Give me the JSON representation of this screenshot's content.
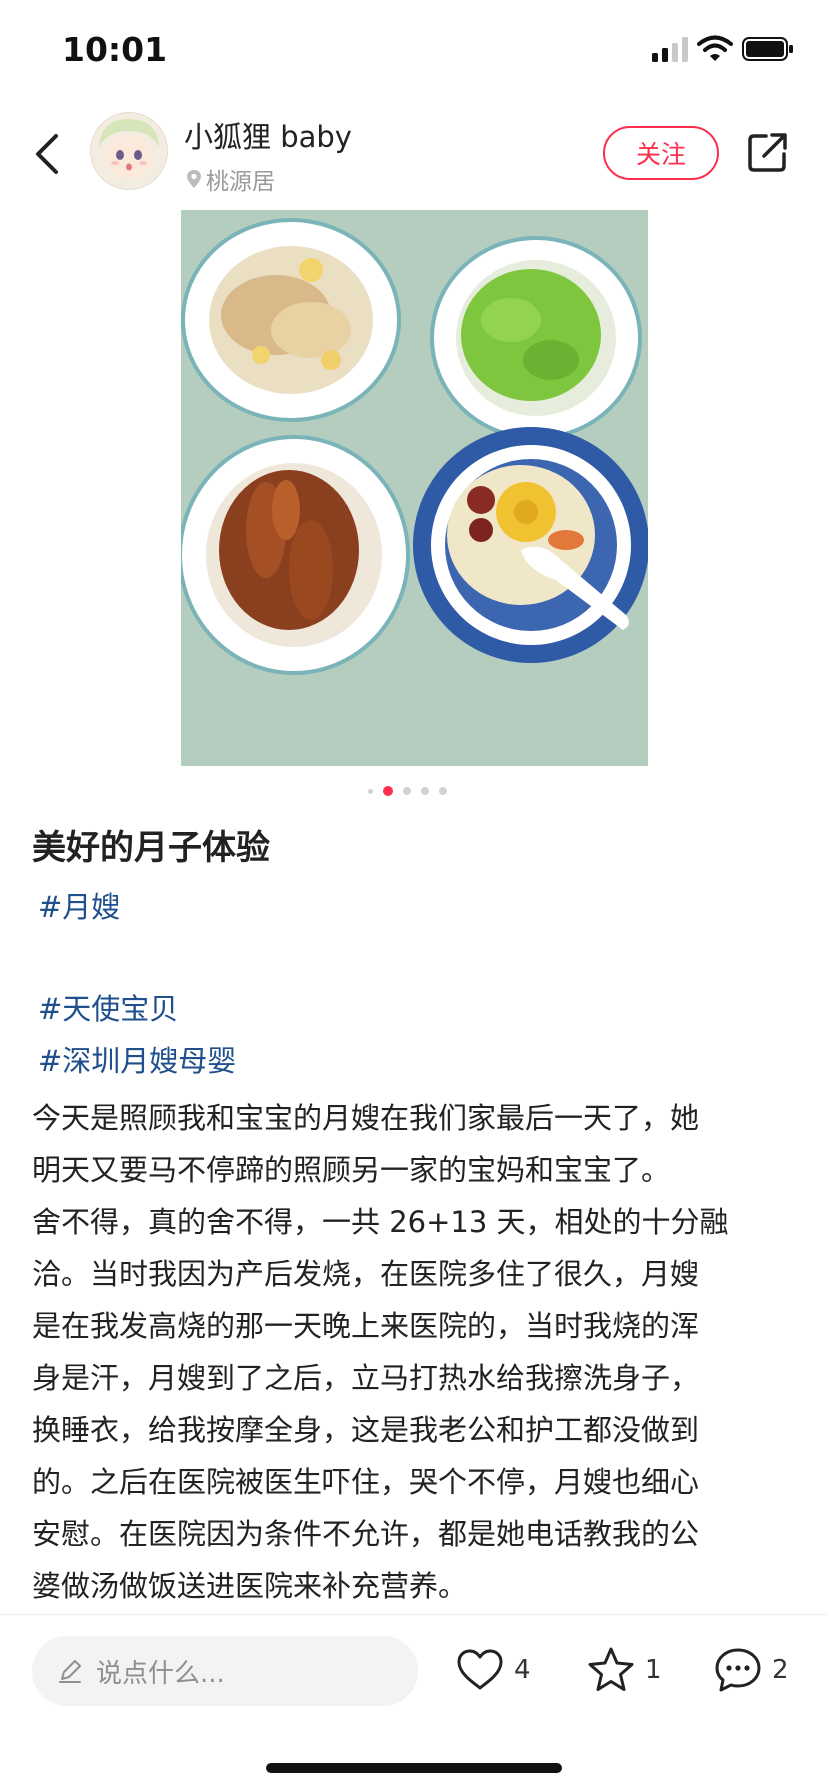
{
  "status_bar": {
    "time": "10:01"
  },
  "header": {
    "author_name": "小狐狸 baby",
    "location": "桃源居",
    "follow_label": "关注"
  },
  "gallery": {
    "total_images": 5,
    "active_index": 1
  },
  "post": {
    "title": "美好的月子体验",
    "tags": [
      "#月嫂",
      "#天使宝贝",
      "#深圳月嫂母婴"
    ],
    "body_lines": [
      "今天是照顾我和宝宝的月嫂在我们家最后一天了，她",
      "明天又要马不停蹄的照顾另一家的宝妈和宝宝了。",
      "舍不得，真的舍不得，一共 26+13 天，相处的十分融",
      "洽。当时我因为产后发烧，在医院多住了很久，月嫂",
      "是在我发高烧的那一天晚上来医院的，当时我烧的浑",
      "身是汗，月嫂到了之后，立马打热水给我擦洗身子，",
      "换睡衣，给我按摩全身，这是我老公和护工都没做到",
      "的。之后在医院被医生吓住，哭个不停，月嫂也细心",
      "安慰。在医院因为条件不允许，都是她电话教我的公",
      "婆做汤做饭送进医院来补充营养。"
    ]
  },
  "bottom_bar": {
    "comment_placeholder": "说点什么...",
    "likes": "4",
    "favorites": "1",
    "comments": "2"
  },
  "colors": {
    "accent": "#ff2e4d",
    "tag": "#1f4f8c"
  }
}
